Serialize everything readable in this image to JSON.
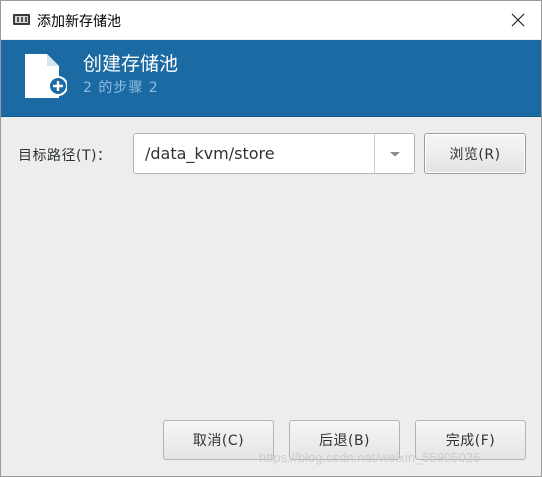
{
  "window": {
    "title": "添加新存储池"
  },
  "header": {
    "title": "创建存储池",
    "step": "2 的步骤 2"
  },
  "form": {
    "target_path_label": "目标路径(T)：",
    "target_path_value": "/data_kvm/store",
    "browse_label": "浏览(R)"
  },
  "footer": {
    "cancel_label": "取消(C)",
    "back_label": "后退(B)",
    "finish_label": "完成(F)"
  },
  "watermark": "https://blog.csdn.net/weixin_55905026",
  "colors": {
    "header_bg": "#1b6aa3",
    "header_subtitle": "#8fbcdf",
    "dialog_bg": "#ededed"
  },
  "icons": {
    "app": "virt-manager-icon",
    "close": "close-icon",
    "header": "new-document-icon",
    "dropdown": "dropdown-arrow-icon"
  }
}
